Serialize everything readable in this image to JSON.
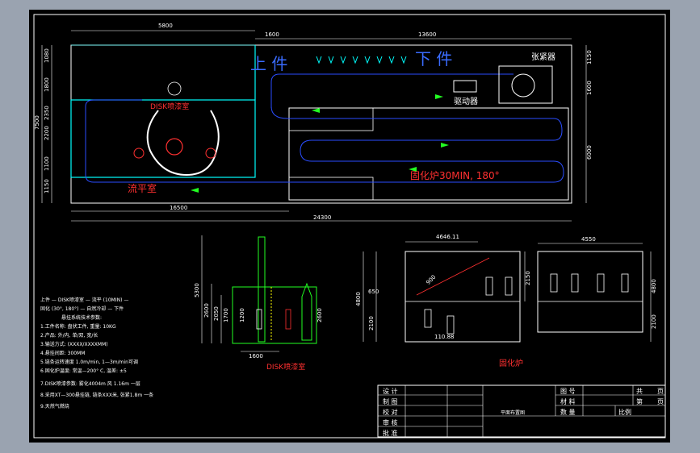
{
  "plan": {
    "label_up": "上 件",
    "label_down": "下 件",
    "label_expander": "张紧器",
    "label_drive": "驱动器",
    "label_disk_booth": "DISK喷漆室",
    "label_leveling": "流平室",
    "label_curing": "固化炉30MIN, 180°",
    "dims": {
      "top_width": "5800",
      "top_mid": "1600",
      "top_right": "13600",
      "left_total": "7500",
      "left_a": "1080",
      "left_b": "1800",
      "left_c": "2200",
      "left_d": "2350",
      "left_e": "1100",
      "left_f": "1150",
      "right_a": "1150",
      "right_b": "1600",
      "right_c": "6000",
      "bottom_left": "16500",
      "bottom_total": "24300"
    }
  },
  "section_disk": {
    "title": "DISK喷漆室",
    "dims": {
      "height": "5300",
      "h2": "2600",
      "h3": "2050",
      "h4": "1700",
      "h5": "1200",
      "h6": "2600",
      "w": "1600"
    }
  },
  "section_oven": {
    "title": "固化炉",
    "dims": {
      "top_w": "4646.11",
      "r_w": "4550",
      "h1": "4800",
      "h2": "650",
      "h3": "2100",
      "h4": "2150",
      "diag": "900",
      "bottom": "110.88",
      "r_h1": "4800",
      "r_h2": "2100"
    }
  },
  "notes": [
    "上件 — DISK喷漆室 — 流平 (10MIN) —",
    "固化 (30°, 180°) — 自然冷却 — 下件",
    "悬挂系统技术参数:",
    "1.工件名称: 盘状工件, 重量: 10KG",
    "2.产品: 外/内, 单/双, 宽/长",
    "3.输送方式: (XXXX/XXXXMM)",
    "4.悬挂间距: 300MM",
    "5.链条运转速度 1.0m/min, 1—3m/min可调",
    "6.固化炉温度: 常温—200° C, 温差: ±5",
    "7.DISK喷漆参数: 雾化4004m 风 1.16m 一层",
    "8.采用XT—300悬挂链, 链条XXX米, 张紧1.8m 一条",
    "9.天然气燃烧"
  ],
  "title_block": {
    "rows": [
      "设 计",
      "制 图",
      "校 对",
      "审 核",
      "批 准"
    ],
    "drawing_name": "平面布置图",
    "fields": {
      "figure_no": "图 号",
      "material": "材 料",
      "quantity": "数 量",
      "scale": "比例",
      "total": "共",
      "sheet": "第",
      "page1": "页",
      "page2": "页"
    }
  }
}
